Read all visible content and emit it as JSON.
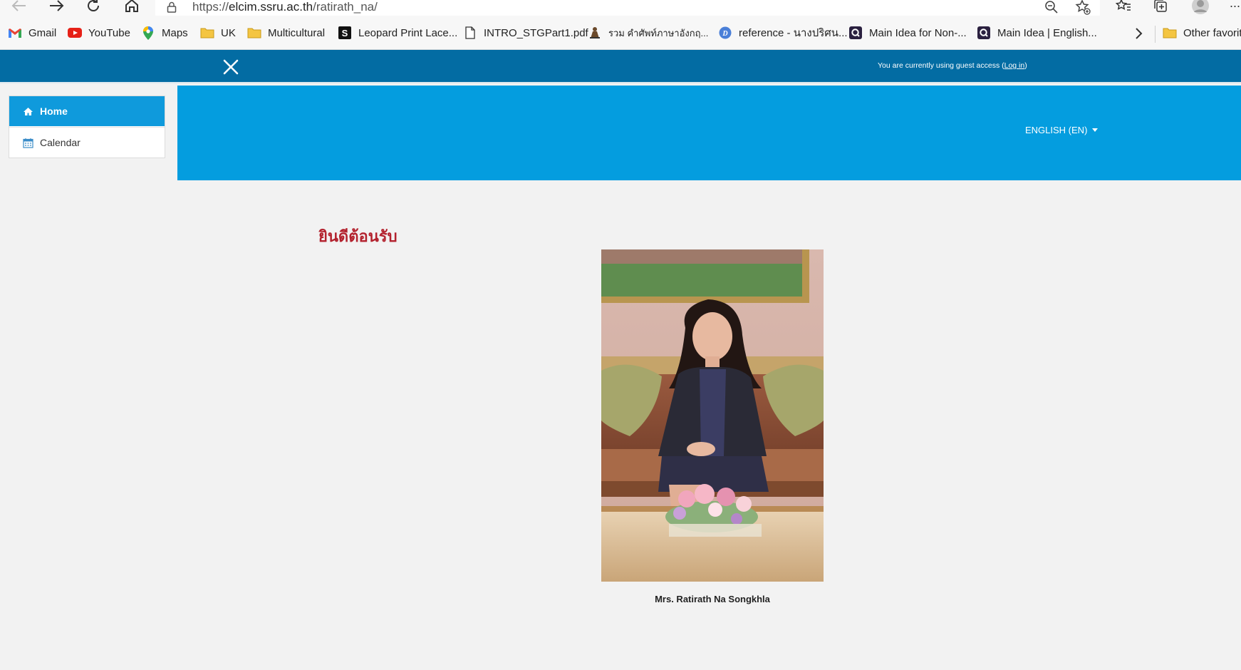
{
  "browser": {
    "url_prefix": "https://",
    "url_host": "elcim.ssru.ac.th",
    "url_path": "/ratirath_na/",
    "more_label": "···",
    "bookmarks": [
      {
        "label": "Gmail"
      },
      {
        "label": "YouTube"
      },
      {
        "label": "Maps"
      },
      {
        "label": "UK"
      },
      {
        "label": "Multicultural"
      },
      {
        "label": "Leopard Print Lace..."
      },
      {
        "label": "INTRO_STGPart1.pdf"
      },
      {
        "label": "รวม คำศัพท์ภาษาอังกฤ..."
      },
      {
        "label": "reference - นางปริศน..."
      },
      {
        "label": "Main Idea for Non-..."
      },
      {
        "label": "Main Idea | English..."
      },
      {
        "label": "Other favorites"
      }
    ]
  },
  "navbar": {
    "guest_text": "You are currently using guest access (",
    "login_label": "Log in",
    "guest_text_end": ")"
  },
  "sidebar": {
    "items": [
      {
        "label": "Home",
        "icon": "home-icon"
      },
      {
        "label": "Calendar",
        "icon": "calendar-icon"
      }
    ]
  },
  "header": {
    "language": "ENGLISH (EN)"
  },
  "content": {
    "welcome": "ยินดีต้อนรับ",
    "caption": "Mrs. Ratirath Na Songkhla"
  },
  "colors": {
    "navbar": "#036ca3",
    "header": "#049ddf",
    "sidebar_active": "#0f9adc",
    "welcome_text": "#b3222e"
  }
}
